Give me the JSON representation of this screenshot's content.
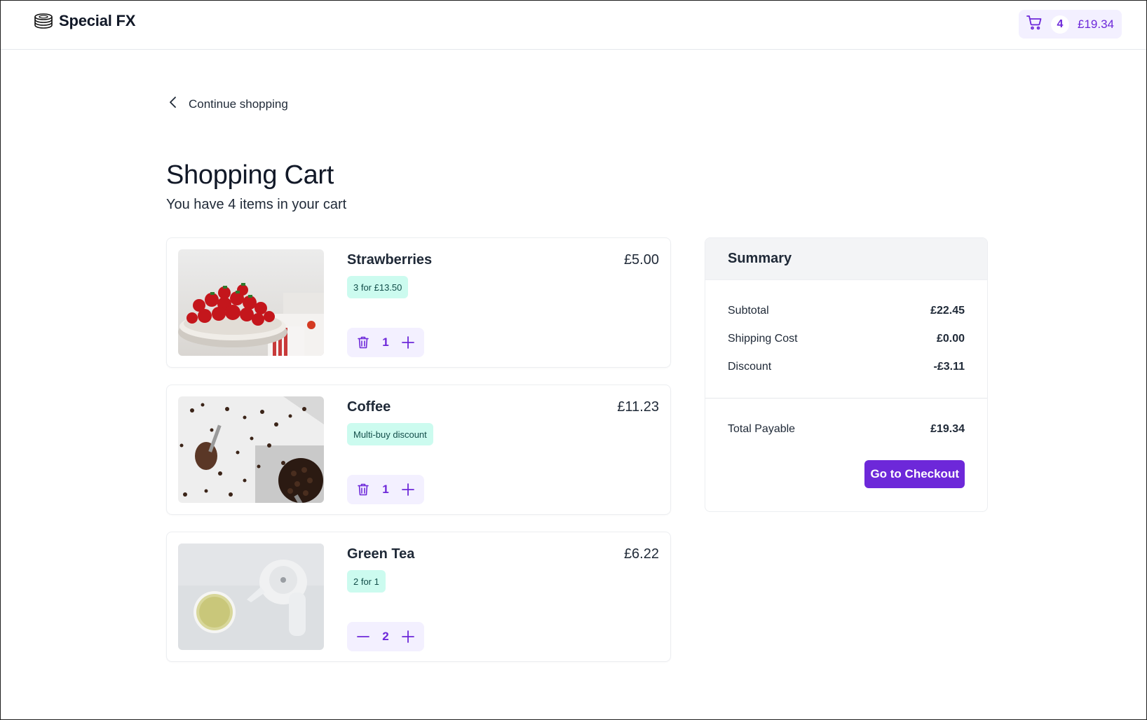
{
  "header": {
    "brand_name": "Special FX",
    "brand_icon": "stacked-discs-icon",
    "cart_icon": "cart-icon",
    "cart_count": "4",
    "cart_total": "£19.34"
  },
  "nav": {
    "back_label": "Continue shopping",
    "back_icon": "chevron-left-icon"
  },
  "page": {
    "title": "Shopping Cart",
    "subtitle": "You have 4 items in your cart"
  },
  "cart_items": [
    {
      "name": "Strawberries",
      "price": "£5.00",
      "promo": "3 for £13.50",
      "quantity": "1",
      "decrement_icon": "trash-icon",
      "increment_icon": "plus-icon",
      "image": "strawberries-bowl"
    },
    {
      "name": "Coffee",
      "price": "£11.23",
      "promo": "Multi-buy discount",
      "quantity": "1",
      "decrement_icon": "trash-icon",
      "increment_icon": "plus-icon",
      "image": "coffee-beans-scoops"
    },
    {
      "name": "Green Tea",
      "price": "£6.22",
      "promo": "2 for 1",
      "quantity": "2",
      "decrement_icon": "minus-icon",
      "increment_icon": "plus-icon",
      "image": "green-tea-teapot"
    }
  ],
  "summary": {
    "title": "Summary",
    "subtotal_label": "Subtotal",
    "subtotal_value": "£22.45",
    "shipping_label": "Shipping Cost",
    "shipping_value": "£0.00",
    "discount_label": "Discount",
    "discount_value": "-£3.11",
    "total_label": "Total Payable",
    "total_value": "£19.34",
    "checkout_label": "Go to Checkout"
  },
  "colors": {
    "accent": "#6d28d9",
    "accent_soft": "#f3f0ff",
    "promo_bg": "#ccfbef",
    "summary_head_bg": "#f3f4f6"
  }
}
